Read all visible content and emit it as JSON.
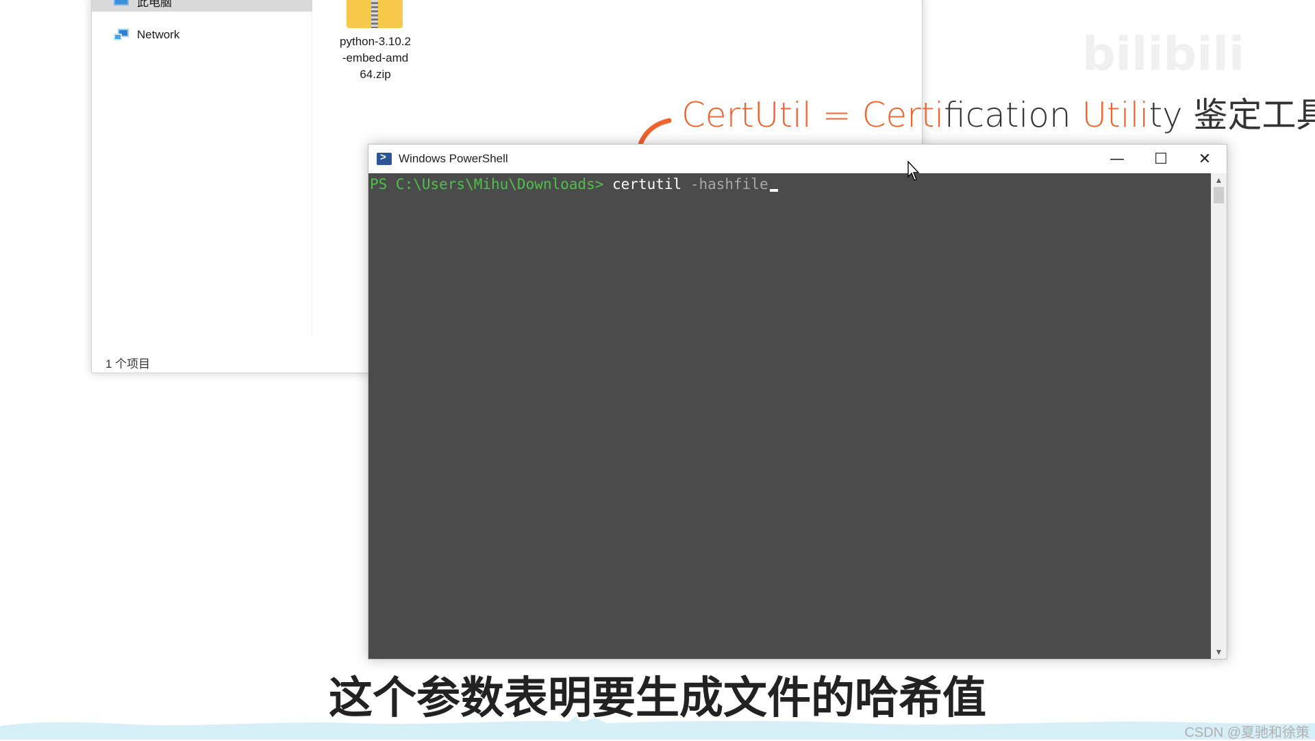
{
  "explorer": {
    "sidebar": {
      "items": [
        {
          "label": "此电脑",
          "icon": "computer-icon"
        },
        {
          "label": "Network",
          "icon": "network-icon"
        }
      ]
    },
    "file": {
      "name_lines": [
        "python-3.10.2",
        "-embed-amd",
        "64.zip"
      ],
      "icon": "zip-folder-icon"
    },
    "status": "1 个项目"
  },
  "annotation": {
    "parts": [
      "CertUtil",
      " = ",
      "Certi",
      "fication ",
      "Utili",
      "ty 鉴定工具"
    ]
  },
  "powershell": {
    "title": "Windows PowerShell",
    "prompt": "PS C:\\Users\\Mihu\\Downloads> ",
    "command": "certutil",
    "parameter": " -hashfile",
    "buttons": {
      "minimize": "—",
      "maximize": "☐",
      "close": "✕"
    }
  },
  "subtitle": "这个参数表明要生成文件的哈希值",
  "watermarks": {
    "top_right": "bilibili",
    "bottom_right": "CSDN @夏驰和徐策"
  },
  "colors": {
    "accent": "#f0622e",
    "prompt_green": "#4fc04a",
    "console_bg": "#4b4b4b"
  }
}
